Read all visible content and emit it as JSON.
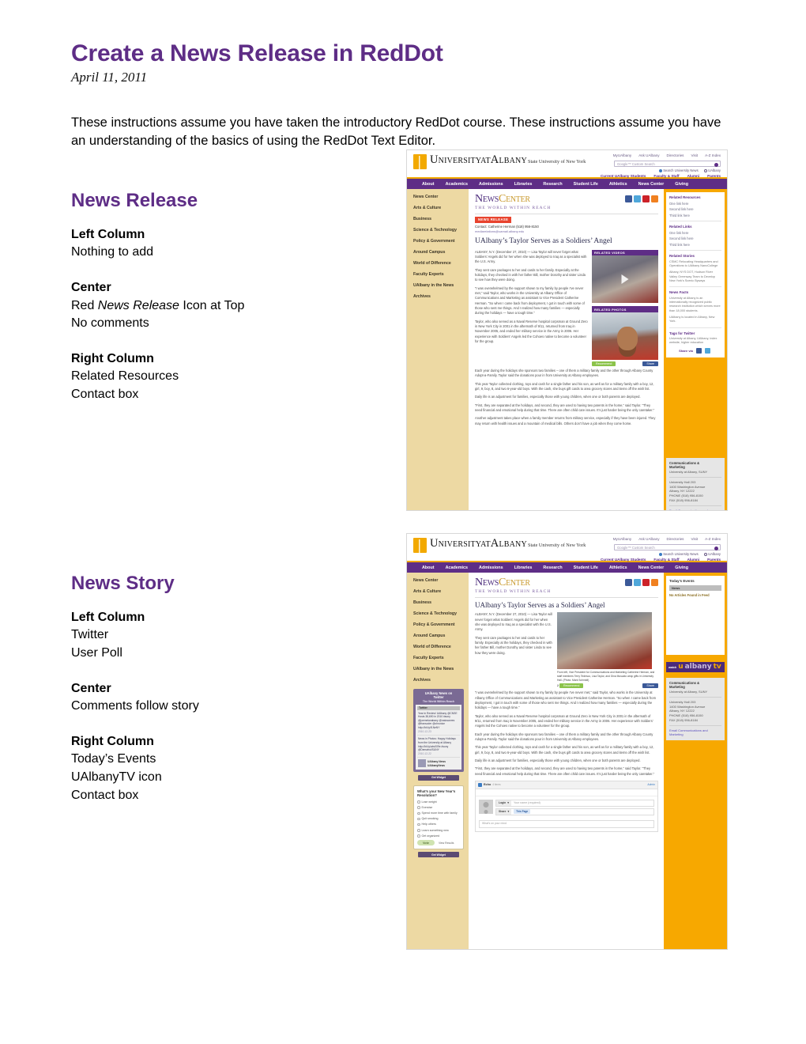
{
  "document": {
    "title": "Create a News Release in RedDot",
    "date": "April 11, 2011",
    "intro": "These instructions assume you have taken the introductory RedDot course. These instructions assume you have an understanding of the basics of using the RedDot Text Editor.",
    "accent_color": "#5E2D86"
  },
  "news_release_section": {
    "heading": "News Release",
    "left_column": {
      "title": "Left Column",
      "lines": [
        "Nothing to add"
      ]
    },
    "center": {
      "title": "Center",
      "line1_pre": "Red ",
      "line1_em": "News Release",
      "line1_post": " Icon at Top",
      "line2": "No comments"
    },
    "right_column": {
      "title": "Right Column",
      "lines": [
        "Related Resources",
        "Contact box"
      ]
    }
  },
  "news_story_section": {
    "heading": "News Story",
    "left_column": {
      "title": "Left Column",
      "lines": [
        "Twitter",
        "User Poll"
      ]
    },
    "center": {
      "title": "Center",
      "lines": [
        "Comments follow story"
      ]
    },
    "right_column": {
      "title": "Right Column",
      "lines": [
        "Today’s Events",
        "UAlbanyTV icon",
        "Contact box"
      ]
    }
  },
  "site": {
    "logo": {
      "line1_a": "U",
      "line1_b": "NIVERSITY",
      "line1_c": "AT",
      "line1_d": "A",
      "line1_e": "LBANY",
      "line2": "State University of New York"
    },
    "util_links": [
      "MyUAlbany",
      "Ask UAlbany",
      "Directories",
      "Visit",
      "A-Z Index"
    ],
    "search_placeholder": "Google™ Custom Search",
    "search_scopes": [
      "Search University News",
      "UAlbany"
    ],
    "audience_links": [
      "Current UAlbany Students",
      "Faculty & Staff",
      "Alumni",
      "Parents"
    ],
    "main_nav": [
      "About",
      "Academics",
      "Admissions",
      "Libraries",
      "Research",
      "Student Life",
      "Athletics",
      "News Center",
      "Giving"
    ],
    "left_nav": [
      "News Center",
      "Arts & Culture",
      "Business",
      "Science & Technology",
      "Policy & Government",
      "Around Campus",
      "World of Difference",
      "Faculty Experts",
      "UAlbany in the News",
      "Archives"
    ],
    "newscenter": {
      "word1": "N",
      "word2": "EWS",
      "word3": "C",
      "word4": "ENTER",
      "tagline": "THE WORLD WITHIN REACH"
    },
    "social_icons": [
      "facebook-icon",
      "twitter-icon",
      "youtube-icon",
      "rss-icon"
    ]
  },
  "article": {
    "badge": "NEWS RELEASE",
    "contact": "Contact: Catherine Herman  (518) 956-8150",
    "contact_email": "mediarelations@uamail.albany.edu",
    "headline": "UAlbany’s Taylor Serves as a Soldiers’ Angel",
    "paragraphs": [
      "ALBANY, N.Y. (December 27, 2010) — Lisa Taylor will never forget what Soldiers’ Angels did for her when she was deployed to Iraq as a specialist with the U.S. Army.",
      "They sent care packages to her and cards to her family. Especially at the holidays, they checked in with her father Bill, mother Dorothy and sister Linda to see how they were doing.",
      "“I was overwhelmed by the support shown to my family by people I’ve never met,” said Taylor, who works in the University at Albany Office of Communications and Marketing as assistant to Vice President Catherine Herman. “So when I came back from deployment, I got in touch with some of those who sent me things. And I realized how many families — especially during the holidays — have a tough time.”",
      "Taylor, who also served as a Naval Reserve hospital corpsman at Ground Zero in New York City in 2001 in the aftermath of 9/11, returned from Iraq in November 2005, and ended her military service in the Army in 2006. Her experience with Soldiers’ Angels led the Cohoes native to become a volunteer for the group.",
      "Each year during the holidays she sponsors two families – one of them a military family and the other through Albany County Adopt-a-Family. Taylor said the donations pour in from University at Albany employees.",
      "This year Taylor collected clothing, toys and cash for a single father and his son, as well as for a military family with a boy, 12, girl, 9, boy, 8, and two 6-year-old boys. With the cash, she buys gift cards to area grocery stores and items off the wish list.",
      "Daily life is an adjustment for families, especially those with young children, when one or both parents are deployed.",
      "“First, they are separated at the holidays, and second, they are used to having two parents in the home,” said Taylor. “They need financial and emotional help during that time. There are often child care issues. It’s just harder being the only caretaker.”",
      "Another adjustment takes place when a family member returns from military service, especially if they have been injured. They may return with health issues and a mountain of medical bills. Others don’t have a job when they come home."
    ],
    "photo_caption": "From left, Vice President for Communications and Marketing Catherine Herman, and staff members Terry Tedesco, Lisa Taylor, and Gina Muscato wrap gifts in University Hall. (Photo: Mark Schmidt)",
    "recommend_count": "2",
    "recommend_label": "Recommend",
    "share_label": "Share"
  },
  "media": {
    "videos_label": "RELATED VIDEOS",
    "photos_label": "RELATED PHOTOS"
  },
  "right_rail": {
    "related_resources": {
      "title": "Related Resources",
      "links": [
        "One link here",
        "Second link here",
        "Third link here"
      ]
    },
    "related_links": {
      "title": "Related Links",
      "links": [
        "One link here",
        "Second link here",
        "Third link here"
      ]
    },
    "related_stories": {
      "title": "Related Stories",
      "items": [
        "CSMC Relocating Headquarters and Operations to UAlbany NanoCollege",
        "Albany, NYS DOT, Hudson River Valley Greenway Team to Develop New York’s Scenic Byways"
      ]
    },
    "news_facts": {
      "title": "News Facts",
      "items": [
        "University at Albany is an internationally recognized public research institution which serves more than 18,000 students.",
        "UAlbany is located in Albany, New York."
      ]
    },
    "tags_for_twitter": {
      "title": "Tags for Twitter",
      "text": "University at Albany, UAlbany, index website, higher education"
    },
    "share_via": "Share via"
  },
  "contact_box": {
    "title_line1": "Communications &",
    "title_line2": "Marketing",
    "org": "University at Albany, SUNY",
    "address": [
      "University Hall 203",
      "1400 Washington Avenue",
      "Albany, NY 12222",
      "PHONE (518) 956-8150",
      "FAX (518) 956-8184"
    ],
    "email_link_line1": "Email Communications and",
    "email_link_line2": "Marketing"
  },
  "story_page": {
    "events": {
      "title": "Today’s Events",
      "sub": "News",
      "message": "No Articles Found in Feed"
    },
    "ualbanytv": {
      "watch": "watch",
      "u": "u",
      "albany": "albany",
      "tv": "tv"
    },
    "twitter_widget": {
      "title_line1": "UAlbany News on",
      "title_line2": "Twitter",
      "subtitle": "The World Within Reach",
      "tab": "Twitter",
      "tweets": [
        {
          "text": "Year in Review! UAlbany @CNSE Hosts 38,690 in 2010 #suny @joemelanabany @natosanres @fransoder @chronice http://bit.ly/f1NeNY",
          "time": "2010-12-23"
        },
        {
          "text": "News in Photos: Happy Holidays from the University at Albany http://bit.ly/abv009e #suny @Dematroi/SUNY",
          "time": "2010-12-22"
        }
      ],
      "account_label": "UAlbany News",
      "account_handle": "UAlbanyNews",
      "follow": "Follow",
      "get_widget": "Get Widget"
    },
    "poll": {
      "question": "What’s your New Year’s Resolution?",
      "options": [
        "Lose weight",
        "Exercise",
        "Spend more time with family",
        "Quit smoking",
        "Help others",
        "Learn something new",
        "Get organized"
      ],
      "vote_label": "Vote",
      "results_label": "View Results",
      "get_widget": "Get Widget"
    },
    "comments": {
      "provider": "Echo",
      "provider_sub": "4 items",
      "admin": "Admin",
      "login_label": "Login",
      "name_placeholder": "Your name (required)",
      "share_label": "Share",
      "share_target": "This Page",
      "textarea_placeholder": "What’s on your mind"
    }
  }
}
